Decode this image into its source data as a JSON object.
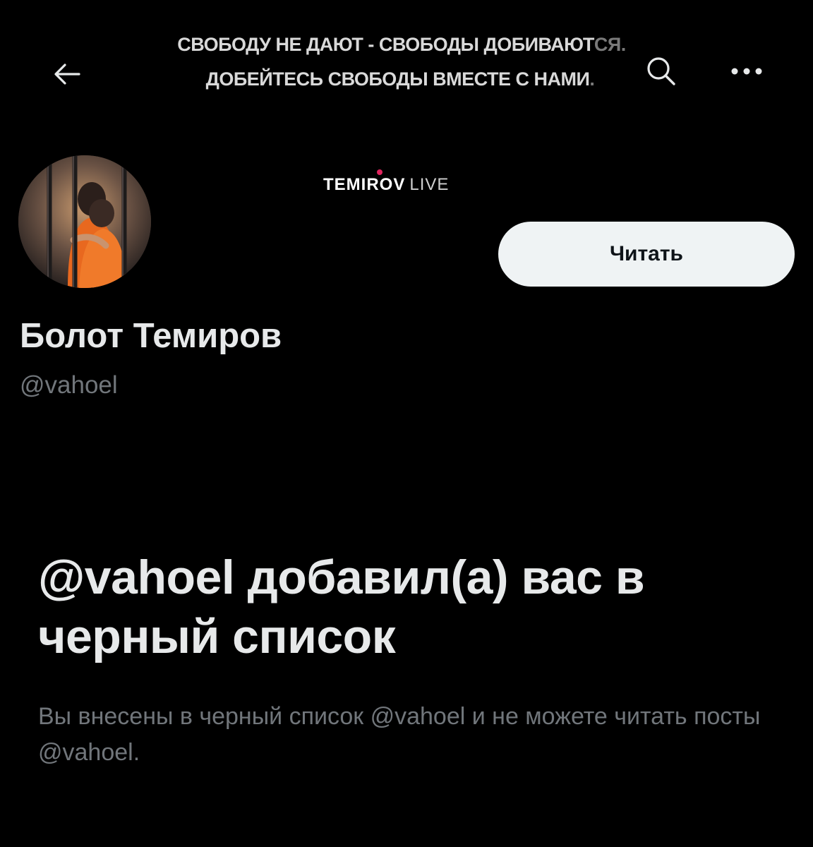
{
  "header": {
    "banner_line_1": "СВОБОДУ НЕ ДАЮТ - СВОБОДЫ ДОБИВАЮТ",
    "banner_line_1_faded": "СЯ.",
    "banner_line_2": "ДОБЕЙТЕСЬ СВОБОДЫ ВМЕСТЕ С НАМИ",
    "banner_line_2_faded": ".",
    "brand_name": "TEMIROV",
    "brand_suffix": "LIVE",
    "back_icon": "arrow-left-icon",
    "search_icon": "search-icon",
    "more_icon": "more-horizontal-icon"
  },
  "profile": {
    "avatar_icon": "profile-avatar",
    "display_name": "Болот Темиров",
    "handle": "@vahoel",
    "follow_label": "Читать"
  },
  "blocked": {
    "title": "@vahoel добавил(а) вас в черный список",
    "description": "Вы внесены в черный список @vahoel и не можете читать посты @vahoel."
  },
  "colors": {
    "background": "#000000",
    "primary_text": "#e7e9ea",
    "secondary_text": "#71767b",
    "button_bg": "#eff3f4",
    "button_text": "#0f1419"
  }
}
